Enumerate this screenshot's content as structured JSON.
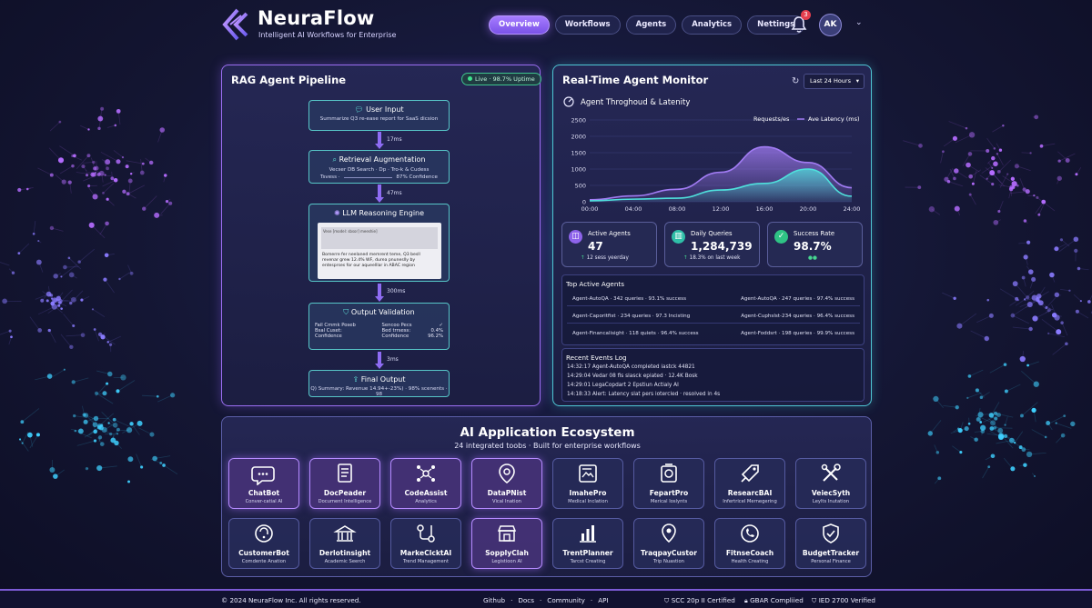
{
  "brand": {
    "name": "NeuraFlow",
    "tagline": "Intelligent AI Workflows for Enterprise"
  },
  "nav": [
    "Overview",
    "Workflows",
    "Agents",
    "Analytics",
    "Nettings"
  ],
  "notifications": {
    "count": "3"
  },
  "user": {
    "initials": "AK"
  },
  "pipeline": {
    "title": "RAG Agent Pipeline",
    "status": "Live · 98.7% Uptime",
    "nodes": {
      "input": {
        "title": "User Input",
        "sub": "Summarize Q3 re-ease report for SaaS dicsion"
      },
      "retrieval": {
        "title": "Retrieval Augmentation",
        "sub1": "Vecser DB Search · Dp · Tro-k & Cudess",
        "sub2": "Tsvess ·",
        "sub3": "87% Confidence"
      },
      "llm": {
        "title": "LLM Reasoning Engine",
        "input_text": "Vese [model: sbsor] meeshie]",
        "output_text": "Bomerre fer neelaned memrent teme, Q3 besll revenar grew 12.4% WF, durea pnuneslly by entesprses for our aqueelllar in ABAC region"
      },
      "validation": {
        "title": "Output Validation",
        "rows": [
          [
            "Fail Cmmk Poseb",
            "Sencoo Pecs",
            "✓"
          ],
          [
            "Bsal Cuset:",
            "Bed trrsess:",
            "0.4%"
          ],
          [
            "Confidence",
            "Confidence",
            "96.2%"
          ]
        ]
      },
      "output": {
        "title": "Final Output",
        "sub": "Q) Summary: Revenue 14.94+-23%) · 98% scenents · 98"
      }
    },
    "latencies": [
      "17ms",
      "47ms",
      "300ms",
      "3ms"
    ]
  },
  "monitor": {
    "title": "Real-Time Agent Monitor",
    "range": "Last 24 Hours",
    "chart_title": "Agent Throghoud & Latenity",
    "stats": [
      {
        "label": "Active Agents",
        "value": "47",
        "sub": "12 sess yeerday"
      },
      {
        "label": "Daily Queries",
        "value": "1,284,739",
        "sub": "18.3% on last week"
      },
      {
        "label": "Success Rate",
        "value": "98.7%",
        "sub": "●●"
      }
    ],
    "top_agents_title": "Top Active Agents",
    "top_agents": [
      [
        "Agent-AutoQA",
        "342 queries · 93.1% success",
        "Agent-AutoQA",
        "247 queries · 97.4% success"
      ],
      [
        "Agent-Caporitfist",
        "234 queries · 97.3 Incisting",
        "Agent-Cuphslst-234 queries",
        "96.4% success"
      ],
      [
        "Agent-Financalisight",
        "118 quiets · 96.4% success",
        "Agent-Foddsrt",
        "198 queries · 99.9% success"
      ]
    ],
    "events_title": "Recent Events Log",
    "events": [
      "14:32:17    Agent-AutoQA completed iastck 44821",
      "14:29:04    Vedar 08 fis slasck epiated · 12.4K Bosk",
      "14:29:01    LegaCopdart 2 Epstiun Actialy AI",
      "14:18:33    Alert: Latency slat pers iotercled · resolved in 4s"
    ]
  },
  "chart_data": {
    "type": "area",
    "x": [
      "00:00",
      "04:00",
      "08:00",
      "12:00",
      "16:00",
      "20:00",
      "24:00"
    ],
    "ylim": [
      0,
      2500
    ],
    "yticks": [
      0,
      500,
      1000,
      1500,
      2000,
      2500
    ],
    "series": [
      {
        "name": "Requests/es",
        "values": [
          60,
          180,
          380,
          900,
          1680,
          1200,
          430
        ],
        "color": "#a27cf4"
      },
      {
        "name": "Ave Latency (ms)",
        "values": [
          30,
          80,
          110,
          360,
          560,
          1000,
          170
        ],
        "color": "#4fe0dc"
      }
    ],
    "legend": "top-right"
  },
  "ecosystem": {
    "title": "AI Application Ecosystem",
    "subtitle": "24 integrated toobs · Built for enterprise workflows",
    "apps": [
      {
        "name": "ChatBot",
        "desc": "Conver-catial AI",
        "icon": "chat-bubble-icon",
        "hl": true
      },
      {
        "name": "DocPeader",
        "desc": "Document Intelligence",
        "icon": "document-icon",
        "hl": true
      },
      {
        "name": "CodeAssist",
        "desc": "Analytics",
        "icon": "network-icon",
        "hl": true
      },
      {
        "name": "DataPNist",
        "desc": "Vical Ination",
        "icon": "eye-icon",
        "hl": true
      },
      {
        "name": "ImahePro",
        "desc": "Medical Inclation",
        "icon": "image-icon",
        "hl": false
      },
      {
        "name": "FepartPro",
        "desc": "Merical Ioslynts",
        "icon": "camera-icon",
        "hl": false
      },
      {
        "name": "ResearcBAI",
        "desc": "Infertricel Mernegering",
        "icon": "tag-icon",
        "hl": false
      },
      {
        "name": "VeiecSyth",
        "desc": "Leylts Inutation",
        "icon": "tools-icon",
        "hl": false
      },
      {
        "name": "CustomerBot",
        "desc": "Comdente Anation",
        "icon": "support-icon",
        "hl": false
      },
      {
        "name": "Derlotinsight",
        "desc": "Academic Seerch",
        "icon": "academic-icon",
        "hl": false
      },
      {
        "name": "MarkeClcktAI",
        "desc": "Trend Management",
        "icon": "flow-icon",
        "hl": false
      },
      {
        "name": "SopplyClah",
        "desc": "Legistioon AI",
        "icon": "store-icon",
        "hl": true
      },
      {
        "name": "TrentPlanner",
        "desc": "Tarcst Creating",
        "icon": "bar-chart-icon",
        "hl": false
      },
      {
        "name": "TraqpayCustor",
        "desc": "Trip Nuastion",
        "icon": "location-icon",
        "hl": false
      },
      {
        "name": "FitnseCoach",
        "desc": "Health Creating",
        "icon": "phone-icon",
        "hl": false
      },
      {
        "name": "BudgetTracker",
        "desc": "Personal Finance",
        "icon": "shield-icon",
        "hl": false
      }
    ]
  },
  "footer": {
    "copyright": "© 2024 NeuraFlow Inc. All rights reserved.",
    "links": [
      "Github",
      "·",
      "Docs",
      "·",
      "Community",
      "·",
      "API"
    ],
    "certs": [
      "SCC 20p II Certified",
      "GBAR Compliied",
      "IED 2700 Verified"
    ]
  }
}
